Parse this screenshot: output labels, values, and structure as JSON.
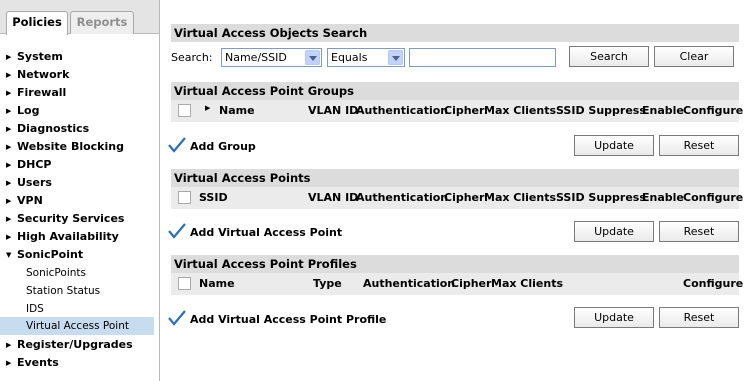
{
  "tabs": {
    "policies": "Policies",
    "reports": "Reports"
  },
  "nav": {
    "items": [
      "System",
      "Network",
      "Firewall",
      "Log",
      "Diagnostics",
      "Website Blocking",
      "DHCP",
      "Users",
      "VPN",
      "Security Services",
      "High Availability",
      "SonicPoint"
    ],
    "sub_items": [
      "SonicPoints",
      "Station Status",
      "IDS",
      "Virtual Access Point"
    ],
    "bottom_items": [
      "Register/Upgrades",
      "Events"
    ],
    "selected": "Virtual Access Point"
  },
  "search": {
    "title": "Virtual Access Objects Search",
    "label": "Search:",
    "field": "Name/SSID",
    "operator": "Equals",
    "value": "",
    "search_button": "Search",
    "clear_button": "Clear"
  },
  "groups": {
    "title": "Virtual Access Point Groups",
    "columns": [
      "Name",
      "VLAN ID",
      "Authentication",
      "Cipher",
      "Max Clients",
      "SSID Suppress",
      "Enable",
      "Configure"
    ],
    "add_label": "Add Group",
    "update": "Update",
    "reset": "Reset"
  },
  "points": {
    "title": "Virtual Access Points",
    "columns": [
      "SSID",
      "VLAN ID",
      "Authentication",
      "Cipher",
      "Max Clients",
      "SSID Suppress",
      "Enable",
      "Configure"
    ],
    "add_label": "Add Virtual Access Point",
    "update": "Update",
    "reset": "Reset"
  },
  "profiles": {
    "title": "Virtual Access Point Profiles",
    "columns": [
      "Name",
      "Type",
      "Authentication",
      "Cipher",
      "Max Clients",
      "Configure"
    ],
    "add_label": "Add Virtual Access Point Profile",
    "update": "Update",
    "reset": "Reset"
  },
  "colors": {
    "selected_bg": "#c8dcef",
    "section_bg": "#dcdcdc",
    "check": "#2f6fb8"
  }
}
